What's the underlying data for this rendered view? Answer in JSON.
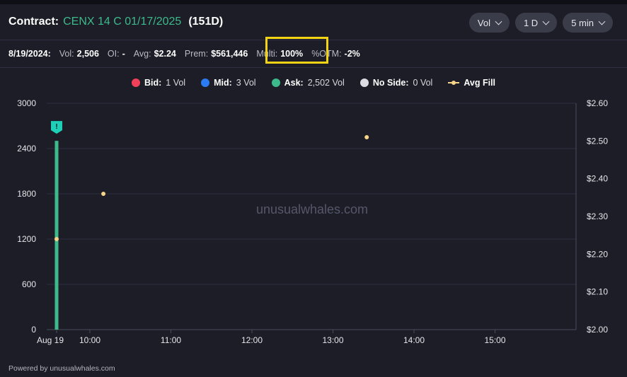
{
  "header": {
    "label": "Contract:",
    "contract": "CENX 14 C 01/17/2025",
    "dte": "(151D)"
  },
  "controls": [
    {
      "value": "Vol"
    },
    {
      "value": "1 D"
    },
    {
      "value": "5 min"
    }
  ],
  "stats": {
    "date": "8/19/2024:",
    "vol_label": "Vol:",
    "vol_value": "2,506",
    "oi_label": "OI:",
    "oi_value": "-",
    "avg_label": "Avg:",
    "avg_value": "$2.24",
    "prem_label": "Prem:",
    "prem_value": "$561,446",
    "multi_label": "Multi:",
    "multi_value": "100%",
    "otm_label": "%OTM:",
    "otm_value": "-2%"
  },
  "legend": [
    {
      "name": "Bid:",
      "value": "1 Vol",
      "color": "#f0405a"
    },
    {
      "name": "Mid:",
      "value": "3 Vol",
      "color": "#2b7cf2"
    },
    {
      "name": "Ask:",
      "value": "2,502 Vol",
      "color": "#3dba8c"
    },
    {
      "name": "No Side:",
      "value": "0 Vol",
      "color": "#dcdce2"
    },
    {
      "name": "Avg Fill",
      "value": "",
      "color": "#f6d488"
    }
  ],
  "watermark": "unusualwhales.com",
  "footer": "Powered by unusualwhales.com",
  "chart_data": {
    "type": "bar",
    "x_tick_labels": [
      "Aug 19",
      "10:00",
      "11:00",
      "12:00",
      "13:00",
      "14:00",
      "15:00"
    ],
    "x_tick_times": [
      "09:30",
      "10:00",
      "11:00",
      "12:00",
      "13:00",
      "14:00",
      "15:00"
    ],
    "x_range": [
      "09:30",
      "16:00"
    ],
    "ylim_left": [
      0,
      3000
    ],
    "left_ticks": [
      "0",
      "600",
      "1200",
      "1800",
      "2400",
      "3000"
    ],
    "ylim_right": [
      2.0,
      2.6
    ],
    "right_ticks": [
      "$2.00",
      "$2.10",
      "$2.20",
      "$2.30",
      "$2.40",
      "$2.50",
      "$2.60"
    ],
    "grid": true,
    "volume_bars": [
      {
        "time": "09:30",
        "volume": 2502,
        "side": "ask",
        "flag": "!"
      }
    ],
    "avg_fill": [
      {
        "time": "09:30",
        "price": 2.24
      },
      {
        "time": "10:10",
        "price": 2.36
      },
      {
        "time": "13:25",
        "price": 2.51
      }
    ],
    "colors": {
      "bar": "#3dba8c",
      "avg_fill": "#f6d488",
      "grid": "#2e3040",
      "flag": "#1fd0b8"
    }
  }
}
